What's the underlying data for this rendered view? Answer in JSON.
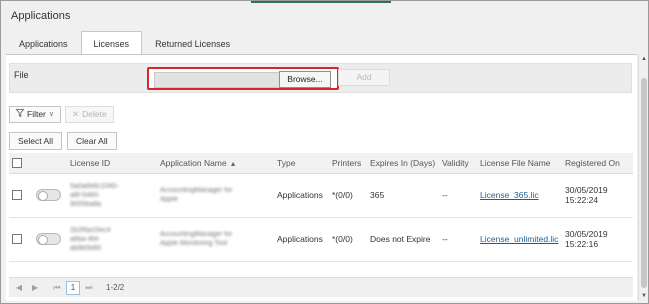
{
  "window": {
    "title": "Applications"
  },
  "tabs": [
    {
      "label": "Applications"
    },
    {
      "label": "Licenses"
    },
    {
      "label": "Returned Licenses"
    }
  ],
  "file_section": {
    "label": "File",
    "browse_label": "Browse...",
    "add_label": "Add",
    "highlight_color": "#d9232d"
  },
  "toolbar": {
    "filter_label": "Filter",
    "delete_label": "Delete",
    "select_all_label": "Select All",
    "clear_all_label": "Clear All"
  },
  "table": {
    "columns": [
      "",
      "License ID",
      "Application Name",
      "Type",
      "Printers",
      "Expires In (Days)",
      "Validity",
      "License File Name",
      "Registered On"
    ],
    "rows": [
      {
        "license_id_lines": [
          "5a0a6b6c1040-",
          "a6f-5460-",
          "9000ba8a"
        ],
        "app_name_lines": [
          "AccountingManager for",
          "Apple"
        ],
        "type": "Applications",
        "printers": "*(0/0)",
        "expires": "365",
        "validity": "--",
        "license_file": "License_365.lic",
        "registered_date": "30/05/2019",
        "registered_time": "15:22:24"
      },
      {
        "license_id_lines": [
          "2b2f6a10ec4",
          "a6ba-4fd-",
          "ab9b5b60"
        ],
        "app_name_lines": [
          "AccountingManager for",
          "Apple Monitoring Tool"
        ],
        "type": "Applications",
        "printers": "*(0/0)",
        "expires": "Does not Expire",
        "validity": "--",
        "license_file": "License_unlimited.lic",
        "registered_date": "30/05/2019",
        "registered_time": "15:22:16"
      }
    ]
  },
  "pager": {
    "current_page": "1",
    "range_text": "1-2/2"
  },
  "colors": {
    "link": "#1a5f9c",
    "accent": "#2f6f5f"
  }
}
